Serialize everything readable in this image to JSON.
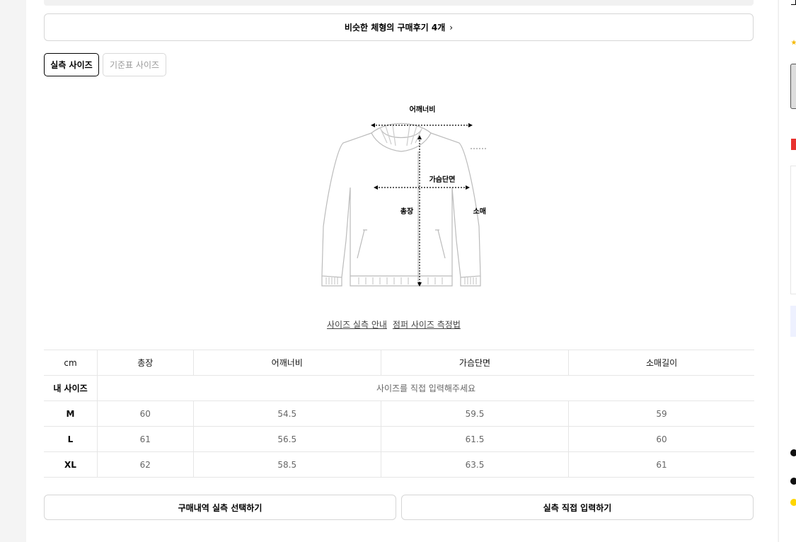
{
  "reviews": {
    "label": "비슷한 체형의 구매후기 4개",
    "chevron": "›"
  },
  "tabs": [
    {
      "label": "실측 사이즈",
      "active": true
    },
    {
      "label": "기준표 사이즈",
      "active": false
    }
  ],
  "diagram": {
    "shoulder": "어깨너비",
    "chest": "가슴단면",
    "length": "총장",
    "sleeve": "소매길이"
  },
  "links": {
    "guide": "사이즈 실측 안내",
    "measure": "점퍼 사이즈 측정법"
  },
  "table": {
    "headers": [
      "cm",
      "총장",
      "어깨너비",
      "가슴단면",
      "소매길이"
    ],
    "my_size": {
      "label": "내 사이즈",
      "prompt": "사이즈를 직접 입력해주세요"
    },
    "rows": [
      {
        "size": "M",
        "values": [
          "60",
          "54.5",
          "59.5",
          "59"
        ]
      },
      {
        "size": "L",
        "values": [
          "61",
          "56.5",
          "61.5",
          "60"
        ]
      },
      {
        "size": "XL",
        "values": [
          "62",
          "58.5",
          "63.5",
          "61"
        ]
      }
    ]
  },
  "buttons": {
    "select_history": "구매내역 실측 선택하기",
    "direct_input": "실측 직접 입력하기"
  },
  "colors": {
    "accent_red": "#e8322f",
    "star": "#f5b800",
    "border": "#d6d6d6"
  }
}
